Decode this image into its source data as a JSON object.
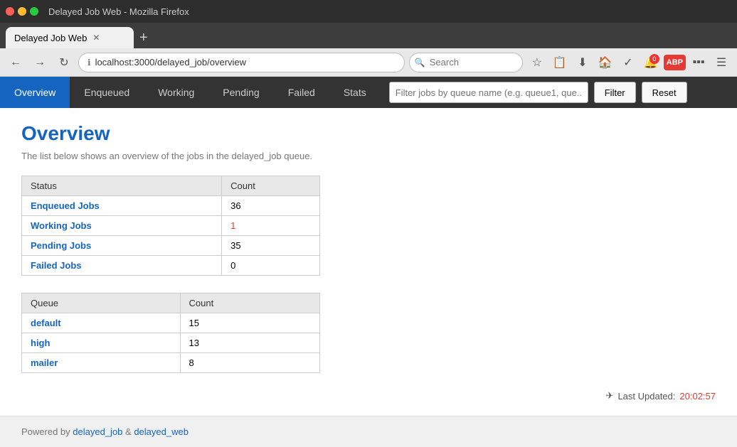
{
  "browser": {
    "title": "Delayed Job Web - Mozilla Firefox",
    "tab_label": "Delayed Job Web",
    "address": "localhost:3000/delayed_job/overview",
    "search_placeholder": "Search"
  },
  "app": {
    "title": "Delayed Job Web",
    "nav": {
      "tabs": [
        {
          "id": "overview",
          "label": "Overview",
          "active": true
        },
        {
          "id": "enqueued",
          "label": "Enqueued",
          "active": false
        },
        {
          "id": "working",
          "label": "Working",
          "active": false
        },
        {
          "id": "pending",
          "label": "Pending",
          "active": false
        },
        {
          "id": "failed",
          "label": "Failed",
          "active": false
        },
        {
          "id": "stats",
          "label": "Stats",
          "active": false
        }
      ],
      "filter_placeholder": "Filter jobs by queue name (e.g. queue1, que...",
      "filter_label": "Filter",
      "reset_label": "Reset"
    }
  },
  "overview": {
    "title": "Overview",
    "subtitle": "The list below shows an overview of the jobs in the delayed_job queue.",
    "status_table": {
      "columns": [
        "Status",
        "Count"
      ],
      "rows": [
        {
          "status": "Enqueued Jobs",
          "count": "36",
          "link": true,
          "red": false
        },
        {
          "status": "Working Jobs",
          "count": "1",
          "link": true,
          "red": true
        },
        {
          "status": "Pending Jobs",
          "count": "35",
          "link": true,
          "red": false
        },
        {
          "status": "Failed Jobs",
          "count": "0",
          "link": true,
          "red": false
        }
      ]
    },
    "queue_table": {
      "columns": [
        "Queue",
        "Count"
      ],
      "rows": [
        {
          "queue": "default",
          "count": "15",
          "link": true
        },
        {
          "queue": "high",
          "count": "13",
          "link": true
        },
        {
          "queue": "mailer",
          "count": "8",
          "link": true
        }
      ]
    },
    "last_updated_label": "Last Updated:",
    "last_updated_time": "20:02:57"
  },
  "footer": {
    "text": "Powered by",
    "link1": "delayed_job",
    "separator": " & ",
    "link2": "delayed_web"
  }
}
